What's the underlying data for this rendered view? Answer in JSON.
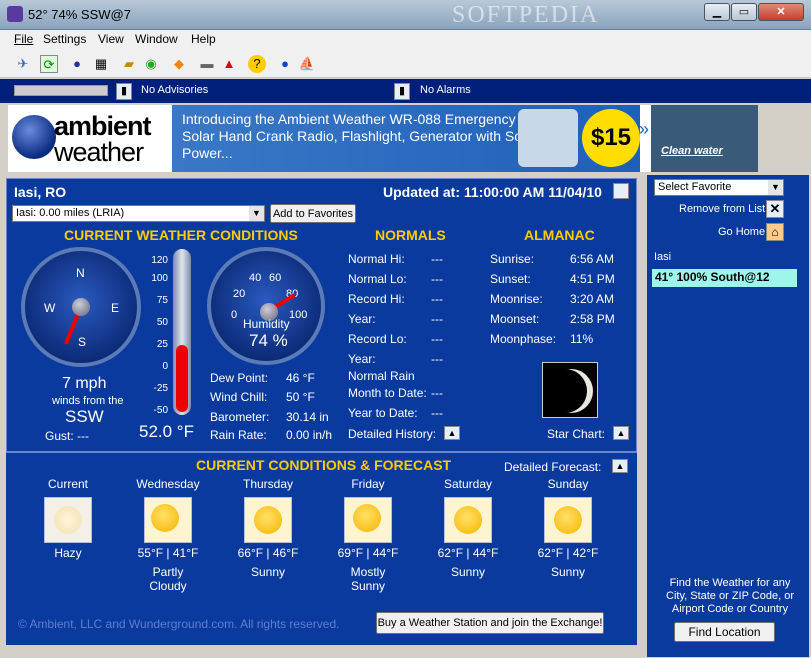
{
  "window": {
    "title": "52° 74% SSW@7",
    "watermark": "SOFTPEDIA"
  },
  "menu": [
    "File",
    "Settings",
    "View",
    "Window",
    "Help"
  ],
  "advisories": {
    "none_text": "No Advisories",
    "alarms_text": "No Alarms"
  },
  "banner": {
    "logo_line1": "ambient",
    "logo_line2": "weather",
    "ad_text": "Introducing the Ambient Weather WR-088 Emergency Solar Hand Crank Radio, Flashlight, Generator with Solar Power...",
    "price": "$15",
    "side_text": "Clean water",
    "arrow": "»"
  },
  "location": {
    "name": "Iasi, RO",
    "updated": "Updated at: 11:00:00 AM 11/04/10",
    "station_select": "Iasi:  0.00 miles (LRIA)",
    "add_fav": "Add to Favorites"
  },
  "sections": {
    "current": "CURRENT WEATHER CONDITIONS",
    "normals": "NORMALS",
    "almanac": "ALMANAC",
    "forecast": "CURRENT CONDITIONS & FORECAST"
  },
  "wind": {
    "speed": "7 mph",
    "from_label": "winds from the",
    "dir": "SSW",
    "gust": "Gust:  ---",
    "n": "N",
    "e": "E",
    "s": "S",
    "w": "W"
  },
  "thermo": {
    "ticks": [
      "120",
      "100",
      "75",
      "50",
      "25",
      "0",
      "-25",
      "-50"
    ],
    "temp": "52.0 °F",
    "level": 0.42
  },
  "humidity": {
    "ticks": [
      "0",
      "20",
      "40",
      "60",
      "80",
      "100"
    ],
    "label": "Humidity",
    "value": "74 %"
  },
  "conditions": [
    {
      "label": "Dew Point:",
      "value": "46 °F"
    },
    {
      "label": "Wind Chill:",
      "value": "50 °F"
    },
    {
      "label": "Barometer:",
      "value": "30.14 in"
    },
    {
      "label": "Rain Rate:",
      "value": "0.00 in/h"
    }
  ],
  "normals": [
    {
      "label": "Normal Hi:",
      "value": "---"
    },
    {
      "label": "Normal Lo:",
      "value": "---"
    },
    {
      "label": "Record Hi:",
      "value": "---"
    },
    {
      "label": "Year:",
      "value": "---"
    },
    {
      "label": "Record Lo:",
      "value": "---"
    },
    {
      "label": "Year:",
      "value": "---"
    }
  ],
  "rain": {
    "normal_label": "Normal Rain",
    "month_label": "Month to Date:",
    "month_value": "---",
    "year_label": "Year to Date:",
    "year_value": "---",
    "history": "Detailed History:"
  },
  "almanac": [
    {
      "label": "Sunrise:",
      "value": "6:56 AM"
    },
    {
      "label": "Sunset:",
      "value": "4:51 PM"
    },
    {
      "label": "Moonrise:",
      "value": "3:20 AM"
    },
    {
      "label": "Moonset:",
      "value": "2:58 PM"
    },
    {
      "label": "Moonphase:",
      "value": "11%"
    }
  ],
  "star_chart": "Star Chart:",
  "detailed_forecast": "Detailed Forecast:",
  "forecast": [
    {
      "day": "Current",
      "temps": "",
      "cond": "Hazy",
      "icon": "haze-icon"
    },
    {
      "day": "Wednesday",
      "temps": "55°F | 41°F",
      "cond": "Partly Cloudy",
      "icon": "partly-cloudy-icon"
    },
    {
      "day": "Thursday",
      "temps": "66°F | 46°F",
      "cond": "Sunny",
      "icon": "sun-icon"
    },
    {
      "day": "Friday",
      "temps": "69°F | 44°F",
      "cond": "Mostly Sunny",
      "icon": "mostly-sunny-icon"
    },
    {
      "day": "Saturday",
      "temps": "62°F | 44°F",
      "cond": "Sunny",
      "icon": "sun-icon"
    },
    {
      "day": "Sunday",
      "temps": "62°F | 42°F",
      "cond": "Sunny",
      "icon": "sun-icon"
    }
  ],
  "footer": {
    "copyright": "© Ambient, LLC and Wunderground.com. All rights reserved.",
    "buy": "Buy a Weather Station and join the Exchange!"
  },
  "sidebar": {
    "favorite_select": "Select Favorite",
    "remove": "Remove from List",
    "home": "Go Home",
    "fav_name": "Iasi",
    "fav_value": "41° 100% South@12",
    "find_text": "Find the Weather for any City, State or ZIP Code, or Airport Code or Country",
    "find_btn": "Find Location"
  },
  "colors": {
    "panel": "#0a3a9e",
    "accent": "#ffcc00",
    "fav_bg": "#9ef5ea"
  }
}
